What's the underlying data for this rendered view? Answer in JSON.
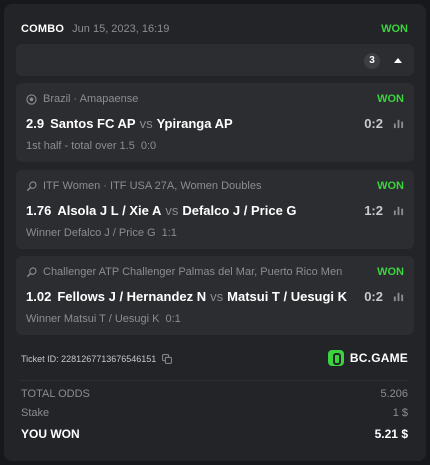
{
  "header": {
    "title": "COMBO",
    "datetime": "Jun 15, 2023, 16:19",
    "status": "WON"
  },
  "selections_count": "3",
  "events": [
    {
      "sport_icon": "soccer-ball-icon",
      "league": "Brazil · Amapaense",
      "status": "WON",
      "odds": "2.9",
      "home": "Santos FC AP",
      "vs": "vs",
      "away": "Ypiranga AP",
      "score": "0:2",
      "market": "1st half - total over 1.5",
      "result": "0:0"
    },
    {
      "sport_icon": "tennis-racket-icon",
      "league": "ITF Women · ITF USA 27A, Women Doubles",
      "status": "WON",
      "odds": "1.76",
      "home": "Alsola J L / Xie A",
      "vs": "vs",
      "away": "Defalco J / Price G",
      "score": "1:2",
      "market": "Winner Defalco J / Price G",
      "result": "1:1"
    },
    {
      "sport_icon": "tennis-racket-icon",
      "league": "Challenger ATP Challenger Palmas del Mar, Puerto Rico Men",
      "status": "WON",
      "odds": "1.02",
      "home": "Fellows J / Hernandez N",
      "vs": "vs",
      "away": "Matsui T / Uesugi K",
      "score": "0:2",
      "market": "Winner Matsui T / Uesugi K",
      "result": "0:1"
    }
  ],
  "ticket": {
    "label": "Ticket ID: 2281267713676546151"
  },
  "brand": {
    "name": "BC.GAME"
  },
  "summary": {
    "total_odds_label": "TOTAL ODDS",
    "total_odds_value": "5.206",
    "stake_label": "Stake",
    "stake_value": "1 $",
    "won_label": "YOU WON",
    "won_value": "5.21 $"
  },
  "colors": {
    "won_green": "#3bd33e",
    "card_bg": "#232427",
    "event_bg": "#2c2d31"
  }
}
